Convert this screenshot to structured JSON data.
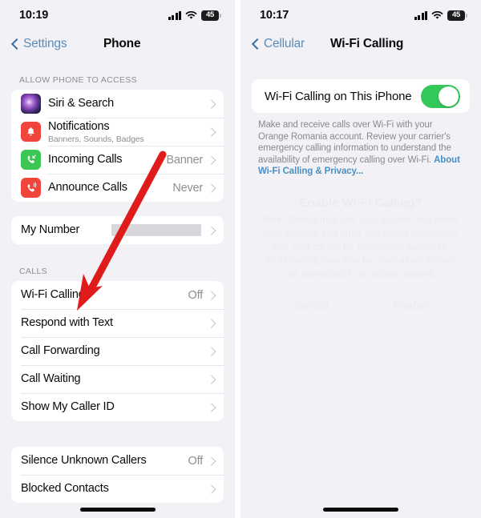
{
  "left": {
    "status": {
      "time": "10:19",
      "battery": "45",
      "signal_icon": "cellular-signal-icon",
      "wifi_icon": "wifi-icon",
      "battery_icon": "battery-icon"
    },
    "nav": {
      "back_label": "Settings",
      "title": "Phone",
      "back_icon": "chevron-left-icon"
    },
    "section1": {
      "header": "ALLOW PHONE TO ACCESS",
      "rows": [
        {
          "title": "Siri & Search",
          "sub": "",
          "value": "",
          "icon": "siri-icon"
        },
        {
          "title": "Notifications",
          "sub": "Banners, Sounds, Badges",
          "value": "",
          "icon": "notifications-bell-icon"
        },
        {
          "title": "Incoming Calls",
          "sub": "",
          "value": "Banner",
          "icon": "incoming-call-icon"
        },
        {
          "title": "Announce Calls",
          "sub": "",
          "value": "Never",
          "icon": "announce-call-icon"
        }
      ]
    },
    "section2": {
      "header": "",
      "rows": [
        {
          "title": "My Number",
          "value": "",
          "redacted": true
        }
      ]
    },
    "section3": {
      "header": "CALLS",
      "rows": [
        {
          "title": "Wi-Fi Calling",
          "value": "Off"
        },
        {
          "title": "Respond with Text",
          "value": ""
        },
        {
          "title": "Call Forwarding",
          "value": ""
        },
        {
          "title": "Call Waiting",
          "value": ""
        },
        {
          "title": "Show My Caller ID",
          "value": ""
        }
      ]
    },
    "section4": {
      "header": "",
      "rows": [
        {
          "title": "Silence Unknown Callers",
          "value": "Off"
        },
        {
          "title": "Blocked Contacts",
          "value": ""
        }
      ]
    },
    "annotation": {
      "type": "red-arrow",
      "color": "#E01B1B",
      "points_to": "Wi-Fi Calling"
    }
  },
  "right": {
    "status": {
      "time": "10:17",
      "battery": "45",
      "signal_icon": "cellular-signal-icon",
      "wifi_icon": "wifi-icon",
      "battery_icon": "battery-icon"
    },
    "nav": {
      "back_label": "Cellular",
      "title": "Wi-Fi Calling",
      "back_icon": "chevron-left-icon"
    },
    "toggle": {
      "label": "Wi-Fi Calling on This iPhone",
      "state": "on",
      "color": "#34C759"
    },
    "footnote": {
      "text": "Make and receive calls over Wi-Fi with your Orange Romania account. Review your carrier's emergency calling information to understand the availability of emergency calling over Wi-Fi. ",
      "link": "About Wi-Fi Calling & Privacy..."
    }
  }
}
